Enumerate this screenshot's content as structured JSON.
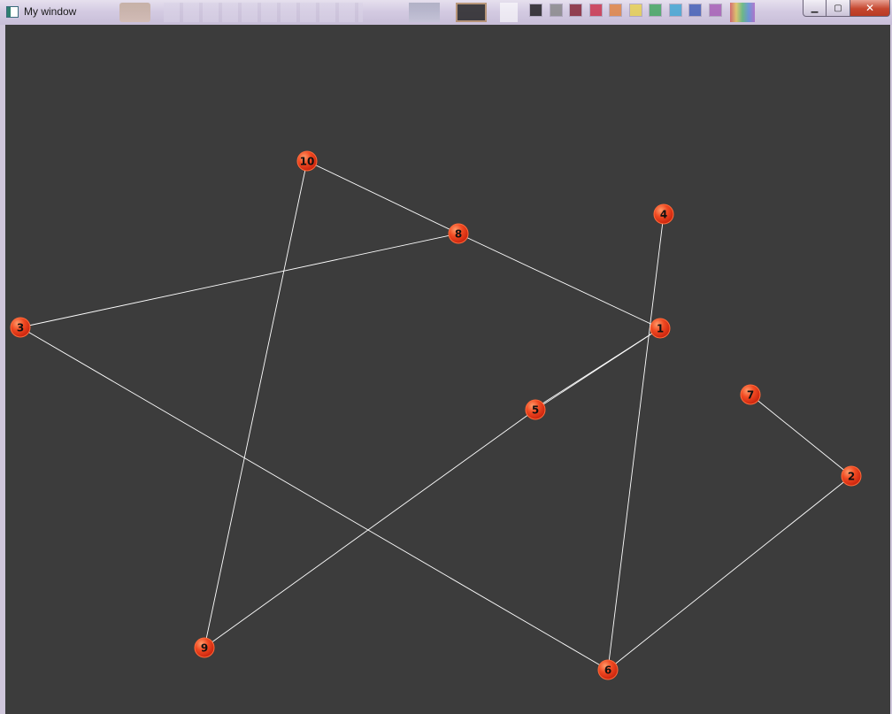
{
  "window": {
    "title": "My window",
    "controls": {
      "minimize": "minimize-icon",
      "maximize": "maximize-icon",
      "close": "close-icon"
    }
  },
  "background_swatches": [
    "#0a0a0a",
    "#7f7f7f",
    "#7a1020",
    "#c8203a",
    "#e07a30",
    "#e8d040",
    "#30a050",
    "#30a0d0",
    "#3050b0",
    "#a050b0"
  ],
  "colors": {
    "canvas": "#3c3c3c",
    "edge": "#ffffff",
    "node_fill": "#e8381c",
    "node_highlight": "#ff8a5a"
  },
  "graph": {
    "nodes": [
      {
        "id": "1",
        "label": "1"
      },
      {
        "id": "2",
        "label": "2"
      },
      {
        "id": "3",
        "label": "3"
      },
      {
        "id": "4",
        "label": "4"
      },
      {
        "id": "5",
        "label": "5"
      },
      {
        "id": "6",
        "label": "6"
      },
      {
        "id": "7",
        "label": "7"
      },
      {
        "id": "8",
        "label": "8"
      },
      {
        "id": "9",
        "label": "9"
      },
      {
        "id": "10",
        "label": "10"
      }
    ],
    "edges": [
      [
        "10",
        "8"
      ],
      [
        "8",
        "1"
      ],
      [
        "8",
        "3"
      ],
      [
        "3",
        "6"
      ],
      [
        "10",
        "9"
      ],
      [
        "9",
        "5"
      ],
      [
        "5",
        "1"
      ],
      [
        "1",
        "5"
      ],
      [
        "4",
        "6"
      ],
      [
        "6",
        "2"
      ],
      [
        "2",
        "7"
      ]
    ]
  }
}
